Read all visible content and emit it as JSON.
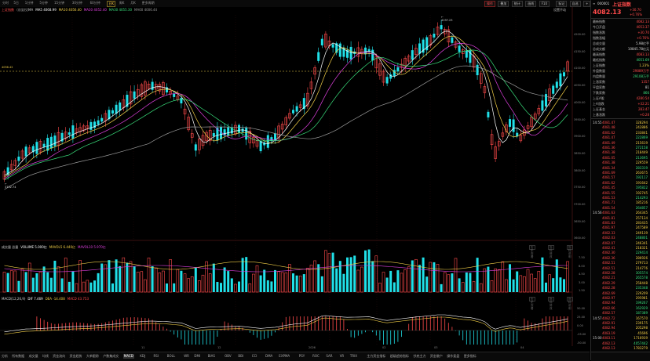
{
  "toolbar": {
    "periods": [
      "分时",
      "5日",
      "1分钟",
      "5分钟",
      "15分钟",
      "30分钟",
      "60分钟",
      "日K",
      "周K",
      "月K",
      "更多周期"
    ],
    "active_period": "日K",
    "right_buttons": [
      "操作",
      "叠加",
      "统计",
      "画线",
      "F10",
      "标记",
      "自选",
      "+",
      "更多"
    ]
  },
  "chart": {
    "title": "上证指数",
    "subtitle": "(前复权)",
    "ma_line": [
      {
        "text": "MA",
        "color": "#d0d0d0"
      },
      {
        "text": "MA5 4068.99",
        "color": "#ffffff"
      },
      {
        "text": "MA10 4056.40",
        "color": "#f2cf47"
      },
      {
        "text": "MA20 4052.40",
        "color": "#e040e0"
      },
      {
        "text": "MA30 4055.30",
        "color": "#39e07c"
      },
      {
        "text": "MA60 4006.44",
        "color": "#9a9a9a"
      }
    ],
    "price_axis": [
      "4200.00",
      "4150.00",
      "4100.00",
      "4050.00",
      "4000.00",
      "3950.00",
      "3900.00",
      "3850.00",
      "3800.00",
      "3750.00",
      "3700.00",
      "3650.00",
      "3600.00"
    ],
    "ref_line_label": "4056.42",
    "high_label": "4197.23",
    "low_label": "3732.74",
    "top_right_label": "设置不动",
    "volume_info": [
      {
        "text": "成交量 总量",
        "color": "#d0d0d0"
      },
      {
        "text": "VOLUME 5.000亿",
        "color": "#ffffff"
      },
      {
        "text": "MAVOL5 6.440亿",
        "color": "#f2cf47"
      },
      {
        "text": "MAVOL10 5.970亿",
        "color": "#e040e0"
      }
    ],
    "volume_axis": [
      "7.50",
      "6.00",
      "4.50",
      "3.00",
      "1.50"
    ],
    "macd_info": [
      {
        "text": "MACD(12,26,9)",
        "color": "#d0d0d0"
      },
      {
        "text": "DIF 7.469",
        "color": "#ffffff"
      },
      {
        "text": "DEA -14.408",
        "color": "#f2cf47"
      },
      {
        "text": "MACD 43.753",
        "color": "#ff4b4b"
      }
    ],
    "macd_axis": [
      "50.00",
      "25.00",
      "0.00",
      "-25.00",
      "-50.00"
    ],
    "x_axis": [
      "11",
      "12",
      "2026",
      "02",
      "03",
      "04"
    ],
    "sub_buttons": [
      "历史查看",
      "指标修改",
      "指标说明"
    ]
  },
  "bottom_tabs": [
    "分析",
    "所有数据",
    "成交量",
    "均线",
    "资金流向",
    "资金趋势",
    "大单跟踪",
    "户数集成交",
    "MACD",
    "KDJ",
    "RSI",
    "BOLL",
    "WR",
    "DMI",
    "BIAS",
    "OBV",
    "BBI",
    "CCI",
    "DMA",
    "EXPMA",
    "PSY",
    "ROC",
    "SAR",
    "VR",
    "TRIX",
    "主力资金指标",
    "超级趋势指标",
    "抄底主力",
    "资金散户",
    "操作复盘",
    "更多指标"
  ],
  "active_bottom_tab": "MACD",
  "quote": {
    "code": "000001",
    "name": "上证指数",
    "price": "4082.13",
    "change": "+30.70",
    "change_pct": "+0.76%",
    "stats": [
      {
        "k": "最新指数",
        "v": "4082.13",
        "c": ""
      },
      {
        "k": "今日开盘",
        "v": "4053.37",
        "c": ""
      },
      {
        "k": "指数涨跌",
        "v": "+30.70",
        "c": ""
      },
      {
        "k": "指数涨幅",
        "v": "+0.76%",
        "c": ""
      },
      {
        "k": "总成交量",
        "v": "5.98亿手",
        "c": "w"
      },
      {
        "k": "总成交额",
        "v": "10845.78亿元",
        "c": "w"
      },
      {
        "k": "最高指数",
        "v": "4083.13",
        "c": ""
      },
      {
        "k": "最低指数",
        "v": "4051.69",
        "c": "g"
      },
      {
        "k": "上证指数",
        "v": "1.23%",
        "c": "y"
      },
      {
        "k": "外盘数量",
        "v": "29889万手",
        "c": ""
      },
      {
        "k": "内盘数量",
        "v": "29108万手",
        "c": "g"
      },
      {
        "k": "上涨家数",
        "v": "1357",
        "c": ""
      },
      {
        "k": "平盘家数",
        "v": "81",
        "c": "w"
      },
      {
        "k": "下跌家数",
        "v": "866",
        "c": "g"
      },
      {
        "k": "上证A股",
        "v": "4280.54",
        "c": ""
      },
      {
        "k": "上A涨跌",
        "v": "+32.21",
        "c": ""
      },
      {
        "k": "上证基金",
        "v": "283.47",
        "c": ""
      },
      {
        "k": "上基涨跌",
        "v": "+0.28",
        "c": ""
      }
    ],
    "ticks": [
      {
        "t": "14:55",
        "p": "4081.47",
        "q": "328294",
        "g": false
      },
      {
        "t": "",
        "p": "4081.48",
        "q": "242886",
        "g": false
      },
      {
        "t": "",
        "p": "4081.62",
        "q": "233841",
        "g": false
      },
      {
        "t": "",
        "p": "4081.47",
        "q": "222869",
        "g": true
      },
      {
        "t": "",
        "p": "4081.49",
        "q": "215619",
        "g": false
      },
      {
        "t": "",
        "p": "4081.36",
        "q": "272158",
        "g": true
      },
      {
        "t": "",
        "p": "4081.38",
        "q": "218449",
        "g": false
      },
      {
        "t": "",
        "p": "4081.05",
        "q": "213695",
        "g": true
      },
      {
        "t": "",
        "p": "4081.38",
        "q": "229559",
        "g": false
      },
      {
        "t": "",
        "p": "4081.34",
        "q": "283319",
        "g": true
      },
      {
        "t": "",
        "p": "4081.69",
        "q": "263675",
        "g": false
      },
      {
        "t": "",
        "p": "4081.57",
        "q": "192117",
        "g": true
      },
      {
        "t": "",
        "p": "4081.62",
        "q": "191642",
        "g": false
      },
      {
        "t": "",
        "p": "4081.45",
        "q": "195822",
        "g": true
      },
      {
        "t": "",
        "p": "4081.55",
        "q": "192745",
        "g": false
      },
      {
        "t": "",
        "p": "4081.53",
        "q": "214293",
        "g": true
      },
      {
        "t": "",
        "p": "4081.71",
        "q": "185216",
        "g": false
      },
      {
        "t": "",
        "p": "4081.54",
        "q": "264857",
        "g": true
      },
      {
        "t": "14:56",
        "p": "4081.63",
        "q": "264345",
        "g": false
      },
      {
        "t": "",
        "p": "4081.81",
        "q": "257134",
        "g": false
      },
      {
        "t": "",
        "p": "4081.83",
        "q": "283435",
        "g": false
      },
      {
        "t": "",
        "p": "4081.97",
        "q": "247589",
        "g": false
      },
      {
        "t": "",
        "p": "4082.33",
        "q": "249139",
        "g": false
      },
      {
        "t": "",
        "p": "4082.03",
        "q": "248801",
        "g": true
      },
      {
        "t": "",
        "p": "4082.07",
        "q": "246341",
        "g": false
      },
      {
        "t": "",
        "p": "4082.41",
        "q": "218321",
        "g": false
      },
      {
        "t": "",
        "p": "4082.30",
        "q": "229414",
        "g": true
      },
      {
        "t": "",
        "p": "4082.36",
        "q": "286926",
        "g": false
      },
      {
        "t": "",
        "p": "4082.51",
        "q": "279713",
        "g": false
      },
      {
        "t": "",
        "p": "4082.51",
        "q": "214776",
        "g": false
      },
      {
        "t": "",
        "p": "4082.28",
        "q": "305574",
        "g": true
      },
      {
        "t": "",
        "p": "4082.21",
        "q": "265578",
        "g": true
      },
      {
        "t": "",
        "p": "4082.29",
        "q": "258448",
        "g": false
      },
      {
        "t": "",
        "p": "4082.28",
        "q": "235348",
        "g": true
      },
      {
        "t": "",
        "p": "4082.69",
        "q": "229209",
        "g": false
      },
      {
        "t": "",
        "p": "4082.97",
        "q": "295981",
        "g": false
      },
      {
        "t": "",
        "p": "4082.94",
        "q": "199267",
        "g": true
      },
      {
        "t": "",
        "p": "4082.66",
        "q": "162929",
        "g": true
      },
      {
        "t": "",
        "p": "4082.57",
        "q": "187389",
        "g": true
      },
      {
        "t": "14:57",
        "p": "4082.72",
        "q": "167570",
        "g": false
      },
      {
        "t": "",
        "p": "4082.91",
        "q": "239175",
        "g": false
      },
      {
        "t": "",
        "p": "4082.94",
        "q": "205298",
        "g": false
      },
      {
        "t": "",
        "p": "4083.19",
        "q": "45696",
        "g": false
      },
      {
        "t": "15:00",
        "p": "4083.11",
        "q": "1716939",
        "g": false
      },
      {
        "t": "",
        "p": "4082.13",
        "q": "4057442",
        "g": true
      },
      {
        "t": "",
        "p": "4082.13",
        "q": "1783279",
        "g": false
      }
    ]
  }
}
